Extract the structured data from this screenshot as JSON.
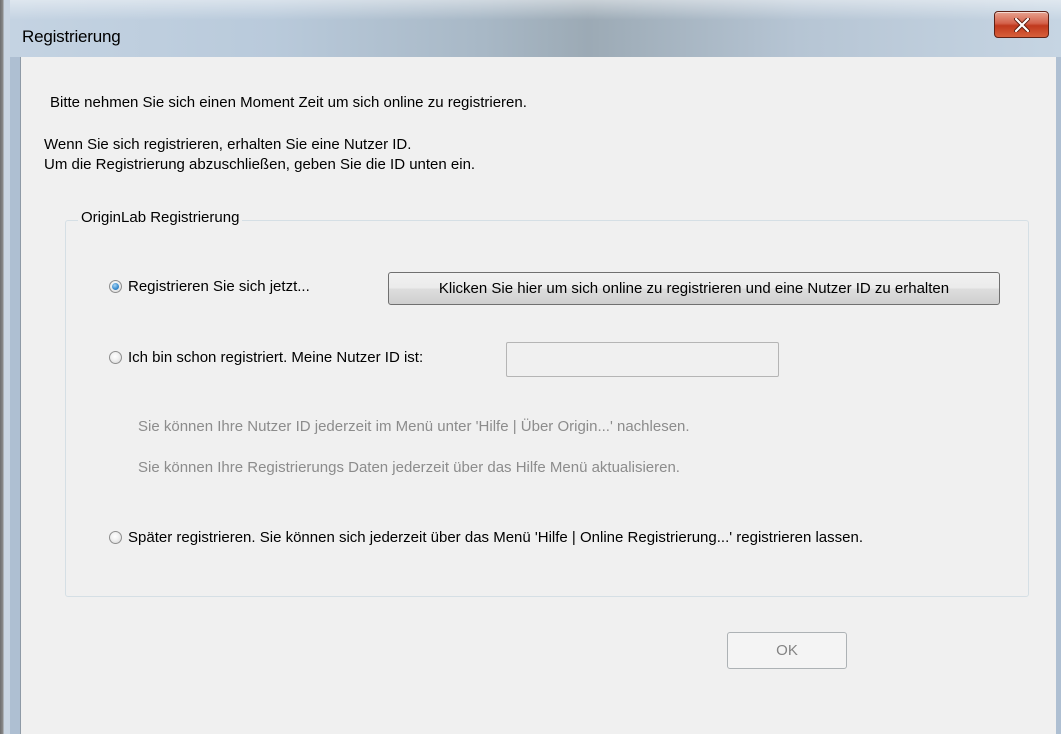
{
  "window": {
    "title": "Registrierung",
    "close_icon": "close-x-icon",
    "accent_close": "#c7432a"
  },
  "intro": {
    "line1": "Bitte nehmen Sie sich einen Moment Zeit um sich online zu registrieren.",
    "line2": "Wenn Sie sich registrieren, erhalten Sie eine Nutzer ID.",
    "line3": "Um die Registrierung abzuschließen, geben Sie die ID unten ein."
  },
  "group": {
    "legend": "OriginLab Registrierung",
    "option_register_now": {
      "label": "Registrieren Sie sich jetzt...",
      "checked": true,
      "button_label": "Klicken Sie hier um sich online zu registrieren und eine Nutzer ID zu erhalten"
    },
    "option_registered": {
      "label": "Ich bin schon registriert. Meine Nutzer ID ist:",
      "checked": false,
      "input_value": "",
      "hint1": "Sie können Ihre Nutzer ID jederzeit im Menü unter 'Hilfe | Über Origin...' nachlesen.",
      "hint2": "Sie können Ihre Registrierungs Daten jederzeit über das Hilfe Menü aktualisieren."
    },
    "option_later": {
      "label": "Später registrieren. Sie können sich jederzeit über das Menü 'Hilfe | Online Registrierung...' registrieren lassen.",
      "checked": false
    }
  },
  "footer": {
    "ok_label": "OK",
    "ok_enabled": false
  }
}
